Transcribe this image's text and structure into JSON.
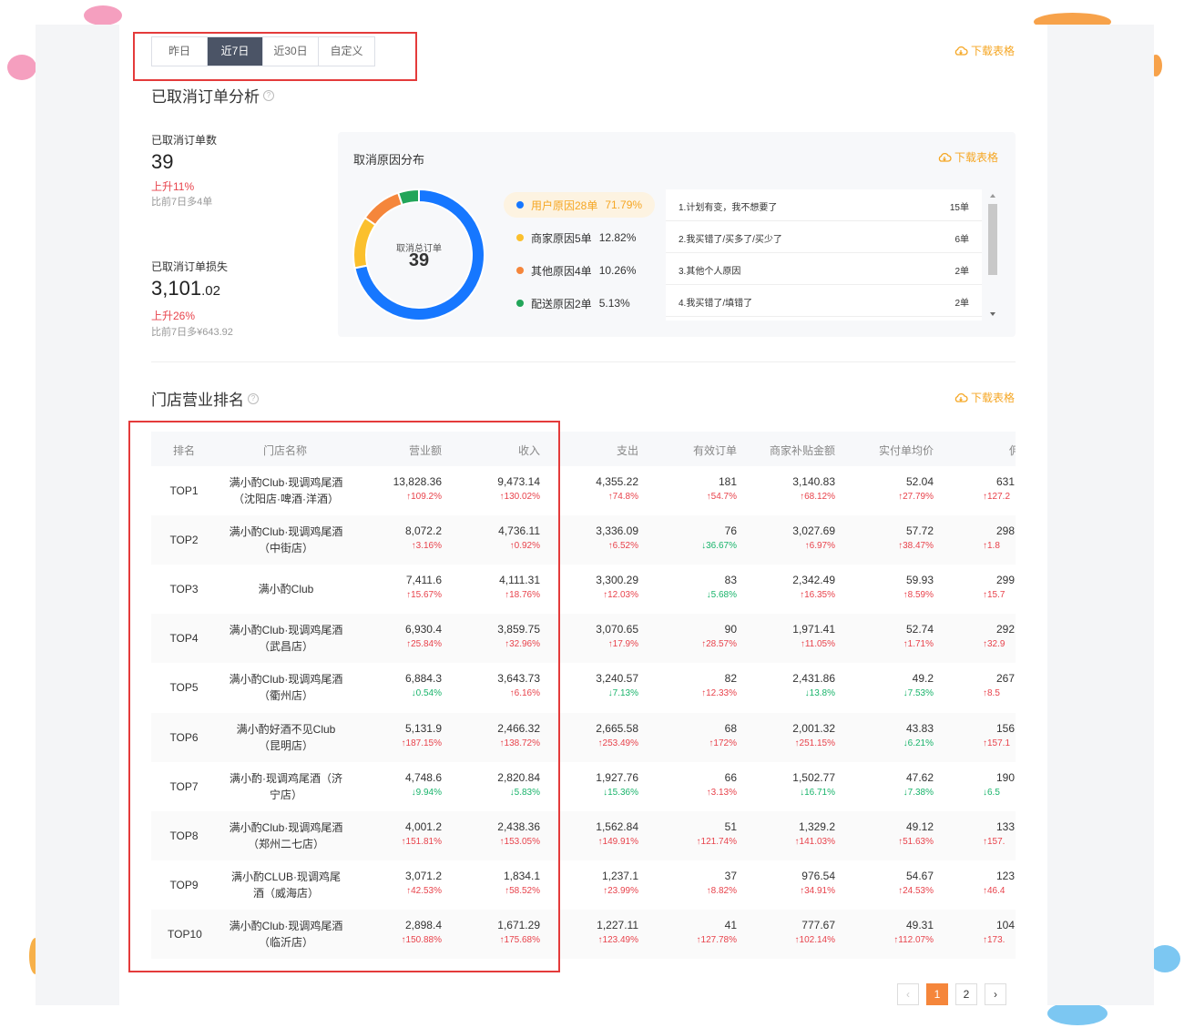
{
  "tabs": [
    "昨日",
    "近7日",
    "近30日",
    "自定义"
  ],
  "download_label": "下载表格",
  "cancel_section": {
    "title": "已取消订单分析",
    "count_label": "已取消订单数",
    "count_value": "39",
    "count_change": "上升11%",
    "count_compare": "比前7日多4单",
    "loss_label": "已取消订单损失",
    "loss_integer": "3,101",
    "loss_decimal": ".02",
    "loss_change": "上升26%",
    "loss_compare": "比前7日多¥643.92"
  },
  "reason_panel": {
    "title": "取消原因分布",
    "donut_center_label": "取消总订单",
    "donut_center_value": "39",
    "segments": [
      {
        "label": "用户原因28单",
        "pct": "71.79%",
        "value": 28,
        "color": "#1677ff"
      },
      {
        "label": "商家原因5单",
        "pct": "12.82%",
        "value": 5,
        "color": "#fbc02d"
      },
      {
        "label": "其他原因4单",
        "pct": "10.26%",
        "value": 4,
        "color": "#f5863b"
      },
      {
        "label": "配送原因2单",
        "pct": "5.13%",
        "value": 2,
        "color": "#22a559"
      }
    ],
    "reasons": [
      {
        "text": "1.计划有变，我不想要了",
        "count": "15单"
      },
      {
        "text": "2.我买错了/买多了/买少了",
        "count": "6单"
      },
      {
        "text": "3.其他个人原因",
        "count": "2单"
      },
      {
        "text": "4.我买错了/填错了",
        "count": "2单"
      }
    ]
  },
  "ranking": {
    "title": "门店营业排名",
    "headers": [
      "排名",
      "门店名称",
      "营业额",
      "收入",
      "支出",
      "有效订单",
      "商家补贴金额",
      "实付单均价",
      "佣"
    ],
    "rows": [
      {
        "rank": "TOP1",
        "name1": "满小酌Club·现调鸡尾酒",
        "name2": "（沈阳店·啤酒·洋酒）",
        "vals": [
          [
            "13,828.36",
            "↑109.2%",
            "up"
          ],
          [
            "9,473.14",
            "↑130.02%",
            "up"
          ],
          [
            "4,355.22",
            "↑74.8%",
            "up"
          ],
          [
            "181",
            "↑54.7%",
            "up"
          ],
          [
            "3,140.83",
            "↑68.12%",
            "up"
          ],
          [
            "52.04",
            "↑27.79%",
            "up"
          ],
          [
            "631",
            "↑127.2",
            "up"
          ]
        ]
      },
      {
        "rank": "TOP2",
        "name1": "满小酌Club·现调鸡尾酒",
        "name2": "（中街店）",
        "vals": [
          [
            "8,072.2",
            "↑3.16%",
            "up"
          ],
          [
            "4,736.11",
            "↑0.92%",
            "up"
          ],
          [
            "3,336.09",
            "↑6.52%",
            "up"
          ],
          [
            "76",
            "↓36.67%",
            "down"
          ],
          [
            "3,027.69",
            "↑6.97%",
            "up"
          ],
          [
            "57.72",
            "↑38.47%",
            "up"
          ],
          [
            "298",
            "↑1.8",
            "up"
          ]
        ]
      },
      {
        "rank": "TOP3",
        "name1": "满小酌Club",
        "name2": "",
        "vals": [
          [
            "7,411.6",
            "↑15.67%",
            "up"
          ],
          [
            "4,111.31",
            "↑18.76%",
            "up"
          ],
          [
            "3,300.29",
            "↑12.03%",
            "up"
          ],
          [
            "83",
            "↓5.68%",
            "down"
          ],
          [
            "2,342.49",
            "↑16.35%",
            "up"
          ],
          [
            "59.93",
            "↑8.59%",
            "up"
          ],
          [
            "299",
            "↑15.7",
            "up"
          ]
        ]
      },
      {
        "rank": "TOP4",
        "name1": "满小酌Club·现调鸡尾酒",
        "name2": "（武昌店）",
        "vals": [
          [
            "6,930.4",
            "↑25.84%",
            "up"
          ],
          [
            "3,859.75",
            "↑32.96%",
            "up"
          ],
          [
            "3,070.65",
            "↑17.9%",
            "up"
          ],
          [
            "90",
            "↑28.57%",
            "up"
          ],
          [
            "1,971.41",
            "↑11.05%",
            "up"
          ],
          [
            "52.74",
            "↑1.71%",
            "up"
          ],
          [
            "292",
            "↑32.9",
            "up"
          ]
        ]
      },
      {
        "rank": "TOP5",
        "name1": "满小酌Club·现调鸡尾酒",
        "name2": "（衢州店）",
        "vals": [
          [
            "6,884.3",
            "↓0.54%",
            "down"
          ],
          [
            "3,643.73",
            "↑6.16%",
            "up"
          ],
          [
            "3,240.57",
            "↓7.13%",
            "down"
          ],
          [
            "82",
            "↑12.33%",
            "up"
          ],
          [
            "2,431.86",
            "↓13.8%",
            "down"
          ],
          [
            "49.2",
            "↓7.53%",
            "down"
          ],
          [
            "267",
            "↑8.5",
            "up"
          ]
        ]
      },
      {
        "rank": "TOP6",
        "name1": "满小酌好酒不见Club",
        "name2": "（昆明店）",
        "vals": [
          [
            "5,131.9",
            "↑187.15%",
            "up"
          ],
          [
            "2,466.32",
            "↑138.72%",
            "up"
          ],
          [
            "2,665.58",
            "↑253.49%",
            "up"
          ],
          [
            "68",
            "↑172%",
            "up"
          ],
          [
            "2,001.32",
            "↑251.15%",
            "up"
          ],
          [
            "43.83",
            "↓6.21%",
            "down"
          ],
          [
            "156",
            "↑157.1",
            "up"
          ]
        ]
      },
      {
        "rank": "TOP7",
        "name1": "满小酌·现调鸡尾酒（济",
        "name2": "宁店）",
        "vals": [
          [
            "4,748.6",
            "↓9.94%",
            "down"
          ],
          [
            "2,820.84",
            "↓5.83%",
            "down"
          ],
          [
            "1,927.76",
            "↓15.36%",
            "down"
          ],
          [
            "66",
            "↑3.13%",
            "up"
          ],
          [
            "1,502.77",
            "↓16.71%",
            "down"
          ],
          [
            "47.62",
            "↓7.38%",
            "down"
          ],
          [
            "190",
            "↓6.5",
            "down"
          ]
        ]
      },
      {
        "rank": "TOP8",
        "name1": "满小酌Club·现调鸡尾酒",
        "name2": "（郑州二七店）",
        "vals": [
          [
            "4,001.2",
            "↑151.81%",
            "up"
          ],
          [
            "2,438.36",
            "↑153.05%",
            "up"
          ],
          [
            "1,562.84",
            "↑149.91%",
            "up"
          ],
          [
            "51",
            "↑121.74%",
            "up"
          ],
          [
            "1,329.2",
            "↑141.03%",
            "up"
          ],
          [
            "49.12",
            "↑51.63%",
            "up"
          ],
          [
            "133",
            "↑157.",
            "up"
          ]
        ]
      },
      {
        "rank": "TOP9",
        "name1": "满小酌CLUB·现调鸡尾",
        "name2": "酒（威海店）",
        "vals": [
          [
            "3,071.2",
            "↑42.53%",
            "up"
          ],
          [
            "1,834.1",
            "↑58.52%",
            "up"
          ],
          [
            "1,237.1",
            "↑23.99%",
            "up"
          ],
          [
            "37",
            "↑8.82%",
            "up"
          ],
          [
            "976.54",
            "↑34.91%",
            "up"
          ],
          [
            "54.67",
            "↑24.53%",
            "up"
          ],
          [
            "123",
            "↑46.4",
            "up"
          ]
        ]
      },
      {
        "rank": "TOP10",
        "name1": "满小酌Club·现调鸡尾酒",
        "name2": "（临沂店）",
        "vals": [
          [
            "2,898.4",
            "↑150.88%",
            "up"
          ],
          [
            "1,671.29",
            "↑175.68%",
            "up"
          ],
          [
            "1,227.11",
            "↑123.49%",
            "up"
          ],
          [
            "41",
            "↑127.78%",
            "up"
          ],
          [
            "777.67",
            "↑102.14%",
            "up"
          ],
          [
            "49.31",
            "↑112.07%",
            "up"
          ],
          [
            "104",
            "↑173.",
            "up"
          ]
        ]
      }
    ]
  },
  "pagination": {
    "prev": "‹",
    "pages": [
      "1",
      "2"
    ],
    "next": "›",
    "current": "1"
  },
  "colors": {
    "accent": "#f5a623",
    "active_tab": "#4b5466",
    "up": "#e8434c",
    "down": "#19b46b",
    "highlight": "#e43b3b"
  }
}
